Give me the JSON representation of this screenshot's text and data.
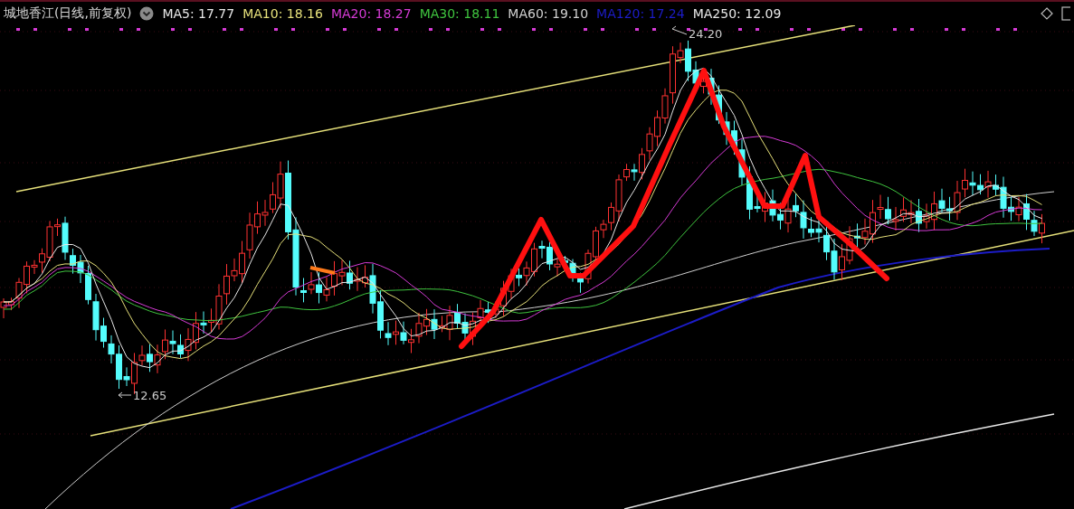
{
  "header": {
    "title": "城地香江(日线,前复权)",
    "indicators": [
      {
        "label": "MA5: 17.77",
        "color": "#e8e8e8"
      },
      {
        "label": "MA10: 18.16",
        "color": "#e6e07a"
      },
      {
        "label": "MA20: 18.27",
        "color": "#d63bd6"
      },
      {
        "label": "MA30: 18.11",
        "color": "#3fc43f"
      },
      {
        "label": "MA60: 19.10",
        "color": "#d0d0d0"
      },
      {
        "label": "MA120: 17.24",
        "color": "#1c1cc8"
      },
      {
        "label": "MA250: 12.09",
        "color": "#e8e8e8"
      }
    ]
  },
  "chart": {
    "high_label": "24.20",
    "low_label": "12.65"
  }
}
